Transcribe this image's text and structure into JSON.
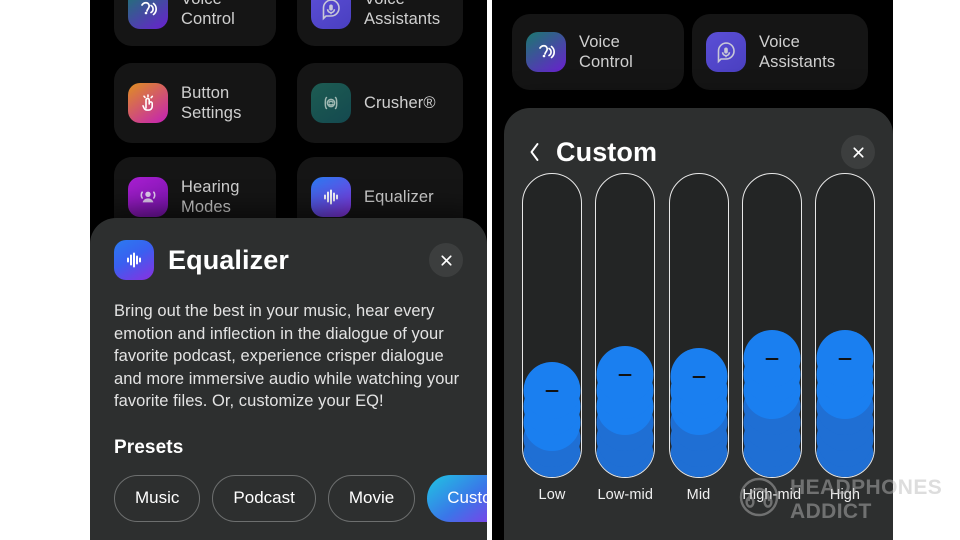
{
  "colors": {
    "page_background": "#ffffff",
    "phone_background": "#000000",
    "tile_background": "#151515",
    "sheet_background": "#2d2f2f",
    "slider_fill": "#1a7ff0",
    "slider_track_outline": "#e8e8e8",
    "chip_active_gradient_from": "#1fc6e2",
    "chip_active_gradient_to": "#a520e8",
    "text_primary": "#ffffff",
    "text_secondary": "#cfcfcf"
  },
  "left_screen": {
    "background_tiles": [
      {
        "label": "Voice Control",
        "icon": "voice-control-icon",
        "gradient_from": "#1a7a6e",
        "gradient_to": "#6a1fd0"
      },
      {
        "label": "Voice Assistants",
        "icon": "voice-assistant-icon",
        "gradient_from": "#5b4fd6",
        "gradient_to": "#4a3fc0"
      },
      {
        "label": "Button Settings",
        "icon": "button-settings-icon",
        "gradient_from": "#e0901f",
        "gradient_to": "#c41fb8"
      },
      {
        "label": "Crusher®",
        "icon": "crusher-icon",
        "gradient_from": "#1d5c52",
        "gradient_to": "#14494f"
      },
      {
        "label": "Hearing Modes",
        "icon": "hearing-modes-icon",
        "gradient_from": "#a81fd0",
        "gradient_to": "#7a14b0"
      },
      {
        "label": "Equalizer",
        "icon": "equalizer-icon",
        "gradient_from": "#2a7bf0",
        "gradient_to": "#8b2fe0"
      }
    ],
    "dialog": {
      "icon": "equalizer-icon",
      "title": "Equalizer",
      "close_label": "close-icon",
      "body": "Bring out the best in your music, hear every emotion and inflection in the dialogue of your favorite podcast, experience crisper dialogue and more immersive audio while watching your favorite files. Or, customize your EQ!",
      "presets_label": "Presets",
      "presets": [
        {
          "label": "Music",
          "selected": false
        },
        {
          "label": "Podcast",
          "selected": false
        },
        {
          "label": "Movie",
          "selected": false
        },
        {
          "label": "Custom",
          "selected": true
        }
      ]
    }
  },
  "right_screen": {
    "background_tiles": [
      {
        "label": "Voice Control",
        "icon": "voice-control-icon",
        "gradient_from": "#1a7a6e",
        "gradient_to": "#6a1fd0"
      },
      {
        "label": "Voice Assistants",
        "icon": "voice-assistant-icon",
        "gradient_from": "#5b4fd6",
        "gradient_to": "#4a3fc0"
      }
    ],
    "card": {
      "back_label": "back-chevron-icon",
      "title": "Custom",
      "close_label": "close-icon"
    }
  },
  "chart_data": {
    "type": "bar",
    "title": "Custom",
    "categories": [
      "Low",
      "Low-mid",
      "Mid",
      "High-mid",
      "High"
    ],
    "values": [
      32,
      45,
      44,
      58,
      58
    ],
    "bubbles": [
      5,
      6,
      6,
      7,
      7
    ],
    "ylabel": "",
    "xlabel": "",
    "ylim": [
      0,
      100
    ],
    "grid": false,
    "legend": false,
    "note": "Vertical EQ band sliders; value = percent of track filled from bottom, bubbles = count of stacked circle segments"
  },
  "watermark": {
    "icon": "headphones-logo-icon",
    "line1": "HEADPHONES",
    "line2": "ADDICT"
  }
}
